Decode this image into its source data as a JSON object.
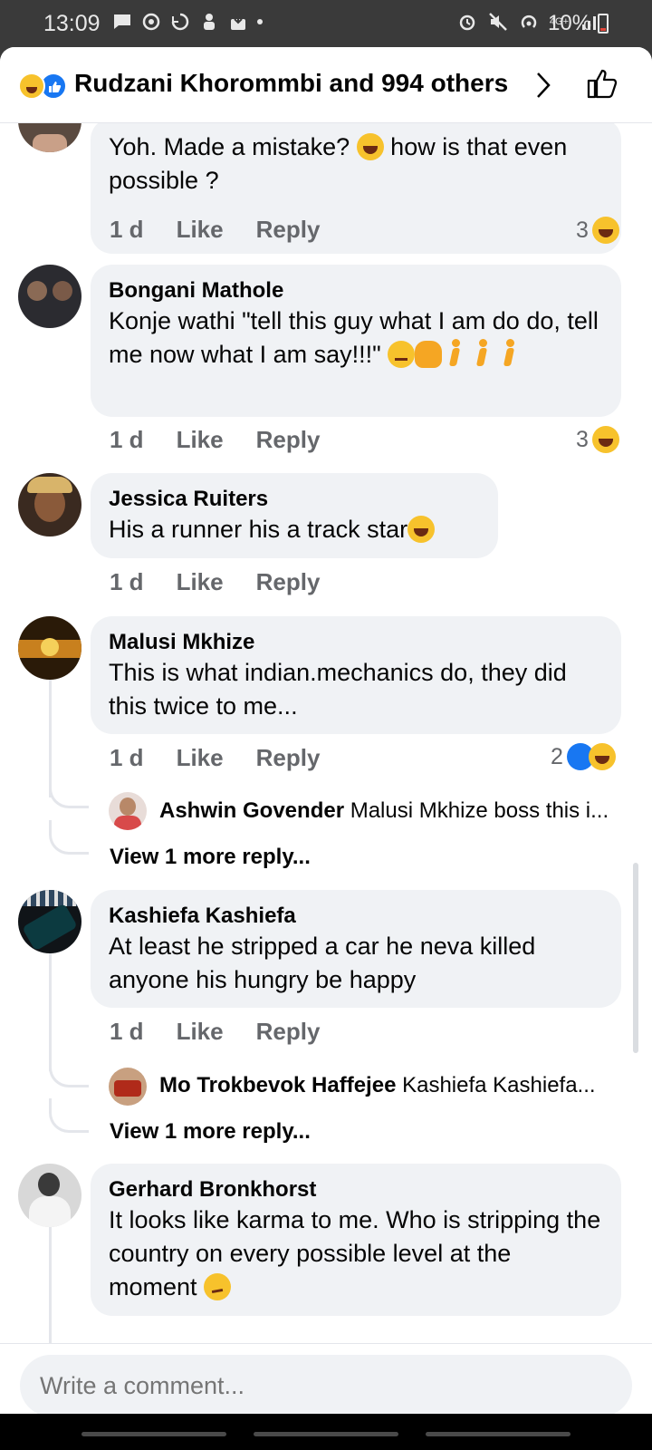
{
  "status_bar": {
    "time": "13:09",
    "battery": "10%",
    "network": "4G+"
  },
  "header": {
    "title": "Rudzani Khorommbi and 994 others"
  },
  "comments": [
    {
      "name": "",
      "text": "Yoh. Made a mistake? ",
      "text2": " how is that even possible ?",
      "time": "1 d",
      "like": "Like",
      "reply": "Reply",
      "count": "3"
    },
    {
      "name": "Bongani Mathole",
      "text": "Konje wathi \"tell this guy what I am do do, tell me now what I am say!!!\"",
      "time": "1 d",
      "like": "Like",
      "reply": "Reply",
      "count": "3"
    },
    {
      "name": "Jessica Ruiters",
      "text": "His a runner his a track star",
      "time": "1 d",
      "like": "Like",
      "reply": "Reply"
    },
    {
      "name": "Malusi Mkhize",
      "text": "This is what indian.mechanics do, they did this twice to me...",
      "time": "1 d",
      "like": "Like",
      "reply": "Reply",
      "count": "2",
      "reply_preview": {
        "name": "Ashwin Govender",
        "text": "Malusi Mkhize boss this i..."
      },
      "view_more": "View 1 more reply..."
    },
    {
      "name": "Kashiefa Kashiefa",
      "text": "At least he stripped a car he neva killed anyone  his hungry be happy",
      "time": "1 d",
      "like": "Like",
      "reply": "Reply",
      "reply_preview": {
        "name": "Mo Trokbevok Haffejee",
        "text": "Kashiefa Kashiefa..."
      },
      "view_more": "View 1 more reply..."
    },
    {
      "name": "Gerhard Bronkhorst",
      "text": "It looks like karma to me. Who is stripping the country on every possible level at the moment",
      "time": "",
      "like": "",
      "reply": ""
    }
  ],
  "composer": {
    "placeholder": "Write a comment..."
  },
  "colors": {
    "like_blue": "#1877f2",
    "bubble": "#f0f2f5",
    "meta_gray": "#65676b",
    "haha_yellow": "#f7c22c"
  },
  "icons": [
    "message-icon",
    "whatsapp-icon",
    "sync-icon",
    "notification-icon",
    "download-icon",
    "alarm-icon",
    "mute-icon",
    "hotspot-icon",
    "signal-icon",
    "battery-icon",
    "haha-reaction-icon",
    "like-reaction-icon",
    "chevron-right-icon",
    "thumbs-up-icon"
  ]
}
